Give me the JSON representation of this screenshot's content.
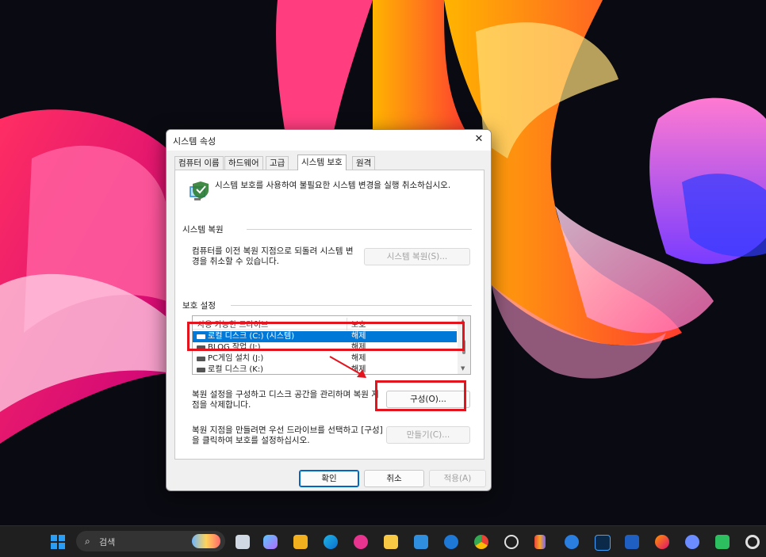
{
  "dialog": {
    "title": "시스템 속성",
    "close_glyph": "✕",
    "tabs": [
      {
        "label": "컴퓨터 이름"
      },
      {
        "label": "하드웨어"
      },
      {
        "label": "고급"
      },
      {
        "label": "시스템 보호"
      },
      {
        "label": "원격"
      }
    ],
    "active_tab": "시스템 보호",
    "intro_text": "시스템 보호를 사용하여 불필요한 시스템 변경을 실행 취소하십시오.",
    "restore_group": {
      "label": "시스템 복원",
      "description": "컴퓨터를 이전 복원 지점으로 되돌려 시스템 변경을 취소할 수 있습니다.",
      "button": "시스템 복원(S)..."
    },
    "protection_group": {
      "label": "보호 설정",
      "columns": [
        "사용 가능한 드라이브",
        "보호"
      ],
      "drives": [
        {
          "name": "로컬 디스크 (C:) (시스템)",
          "protection": "해제",
          "selected": true
        },
        {
          "name": "BLOG 작업 (I:)",
          "protection": "해제",
          "selected": false
        },
        {
          "name": "PC게임 설치 (J:)",
          "protection": "해제",
          "selected": false
        },
        {
          "name": "로컬 디스크 (K:)",
          "protection": "해제",
          "selected": false
        }
      ],
      "configure_description": "복원 설정을 구성하고 디스크 공간을 관리하며 복원 지점을 삭제합니다.",
      "configure_button": "구성(O)...",
      "create_description": "복원 지점을 만들려면 우선 드라이브를 선택하고 [구성]을 클릭하여 보호를 설정하십시오.",
      "create_button": "만들기(C)..."
    },
    "footer": {
      "ok": "확인",
      "cancel": "취소",
      "apply": "적용(A)"
    }
  },
  "taskbar": {
    "search_placeholder": "검색",
    "icons": [
      "start-icon",
      "search-icon",
      "task-view-icon",
      "copilot-icon",
      "store-icon",
      "edge-icon",
      "app-icon",
      "file-explorer-icon",
      "notepad-icon",
      "app-icon",
      "chrome-icon",
      "app-icon",
      "app-icon",
      "todo-icon",
      "lightroom-icon",
      "word-icon",
      "firefox-icon",
      "app-icon",
      "evernote-icon",
      "app-icon"
    ]
  },
  "colors": {
    "selection": "#0078d7",
    "annotation_red": "#e3141e",
    "taskbar": "#1f1f1f"
  }
}
